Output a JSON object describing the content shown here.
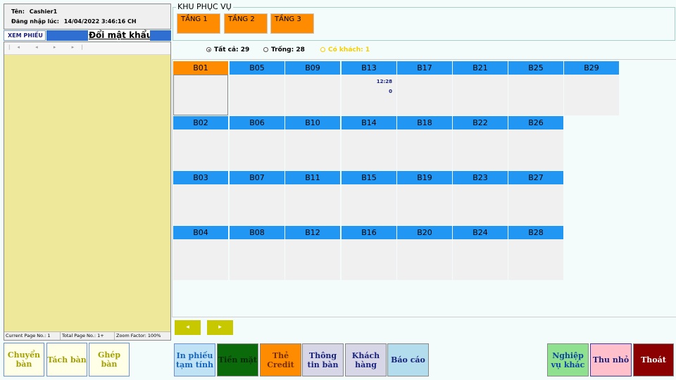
{
  "user": {
    "name_label": "Tên:",
    "name_value": "Cashier1",
    "login_label": "Đăng nhập lúc:",
    "login_value": "14/04/2022 3:46:16 CH"
  },
  "left_tabs": {
    "xem_phieu": "XEM PHIẾU",
    "doi_mat_khau": "Đổi mật khẩu"
  },
  "viewer": {
    "toolbar_icons": [
      "first-page-icon",
      "prev-page-icon",
      "next-page-icon",
      "last-page-icon"
    ],
    "toolbar_glyphs": "|◂ ◂ ▸ ▸|",
    "status": {
      "current_page": "Current Page No.: 1",
      "total_page": "Total Page No.: 1+",
      "zoom": "Zoom Factor: 100%"
    }
  },
  "left_buttons": {
    "chuyen_ban": "Chuyển bàn",
    "tach_ban": "Tách bàn",
    "ghep_ban": "Ghép bàn"
  },
  "zone": {
    "title": "KHU PHỤC VỤ",
    "floors": [
      "TẦNG 1",
      "TẦNG 2",
      "TẦNG 3"
    ]
  },
  "filters": {
    "all": "Tất cả: 29",
    "empty": "Trống: 28",
    "occupied": "Có khách: 1"
  },
  "tables": {
    "col1": [
      "B01",
      "B02",
      "B03",
      "B04"
    ],
    "col2": [
      "B05",
      "B06",
      "B07",
      "B08"
    ],
    "col3": [
      "B09",
      "B10",
      "B11",
      "B12"
    ],
    "col4": [
      "B13",
      "B14",
      "B15",
      "B16"
    ],
    "col5": [
      "B17",
      "B18",
      "B19",
      "B20"
    ],
    "col6": [
      "B21",
      "B22",
      "B23",
      "B24"
    ],
    "col7": [
      "B25",
      "B26",
      "B27",
      "B28"
    ],
    "col8": [
      "B29"
    ],
    "b13_time": "12:28",
    "b13_amount": "0"
  },
  "nav": {
    "prev": "◂",
    "next": "▸"
  },
  "actions": {
    "in_phieu": "In phiếu tạm tính",
    "tien_mat": "Tiền mặt",
    "the_credit": "Thẻ Credit",
    "thong_tin_ban": "Thông tin bàn",
    "khach_hang": "Khách hàng",
    "bao_cao": "Báo cáo",
    "nghiep_vu_khac": "Nghiệp vụ khác",
    "thu_nho": "Thu nhỏ",
    "thoat": "Thoát"
  },
  "colors": {
    "table_header": "#2196f3",
    "table_selected": "#ff8c00",
    "floor_button": "#ff8c00",
    "viewer_bg": "#ede89a"
  }
}
